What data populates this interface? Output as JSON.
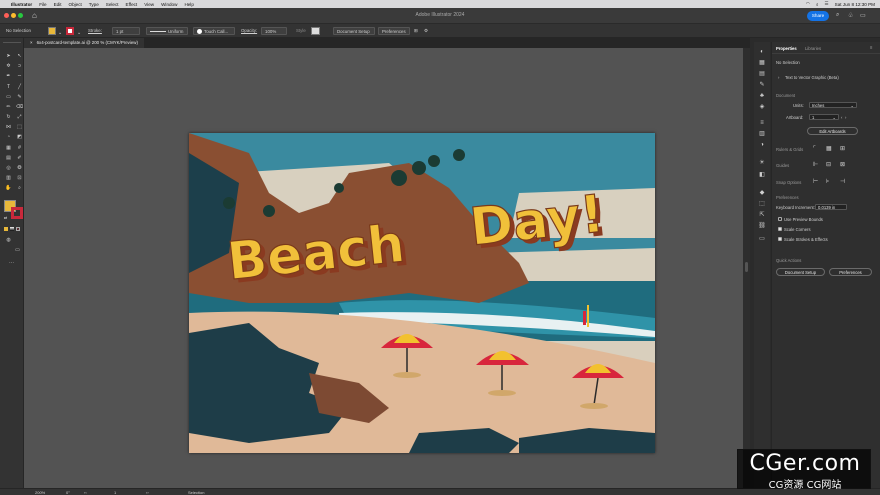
{
  "menubar": {
    "app": "Illustrator",
    "items": [
      "File",
      "Edit",
      "Object",
      "Type",
      "Select",
      "Effect",
      "View",
      "Window",
      "Help"
    ],
    "clock": "Sat Jun 8  12:30 PM"
  },
  "window": {
    "title": "Adobe Illustrator 2024",
    "share_label": "Share"
  },
  "control_bar": {
    "selection": "No Selection",
    "stroke_label": "Stroke:",
    "stroke_value": "1 pt",
    "profile": "Uniform",
    "brush": "Touch Call...",
    "opacity_label": "Opacity:",
    "opacity_value": "100%",
    "style_label": "Style",
    "document_setup": "Document Setup",
    "preferences": "Preferences",
    "fill_color": "#e8b83a",
    "stroke_color": "#c8293b"
  },
  "tab": {
    "name": "6x4-postcard-template.ai @ 200 % (CMYK/Preview)"
  },
  "artwork": {
    "headline_1": "Beach",
    "headline_2": "Day!"
  },
  "panel": {
    "tabs": [
      "Properties",
      "Libraries"
    ],
    "selection": "No Selection",
    "text_to_vector": "Text to Vector Graphic (Beta)",
    "document_header": "Document",
    "units_label": "Units:",
    "units_value": "Inches",
    "artboard_label": "Artboard:",
    "artboard_value": "1",
    "edit_artboards": "Edit Artboards",
    "rulers_grids": "Rulers & Grids",
    "guides": "Guides",
    "snap_options": "Snap Options",
    "preferences_header": "Preferences",
    "keyboard_increment_label": "Keyboard Increment:",
    "keyboard_increment_value": "0.0139 in",
    "use_preview_bounds": "Use Preview Bounds",
    "scale_corners": "Scale Corners",
    "scale_strokes": "Scale Strokes & Effects",
    "quick_actions": "Quick Actions",
    "document_setup_btn": "Document Setup",
    "preferences_btn": "Preferences",
    "checkboxes": {
      "use_preview_bounds": false,
      "scale_corners": true,
      "scale_strokes": true
    }
  },
  "status": {
    "zoom": "200%",
    "rotation": "0°",
    "artboard": "1",
    "tool": "Selection"
  },
  "watermark": {
    "line1": "CGer.com",
    "line2": "CG资源  CG网站"
  }
}
